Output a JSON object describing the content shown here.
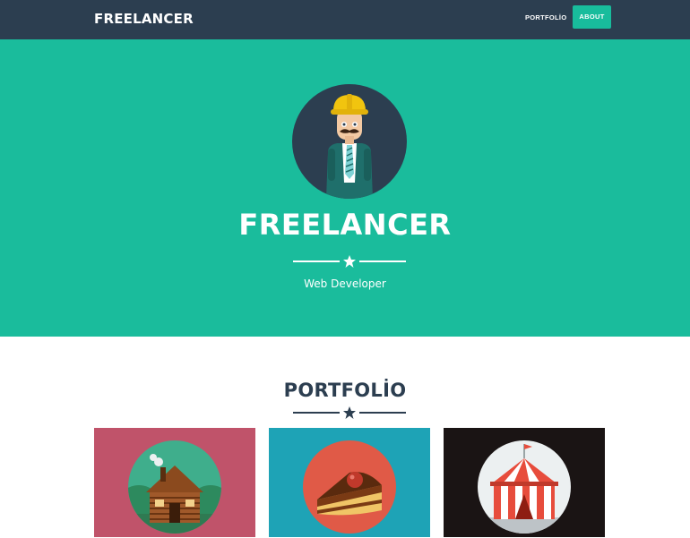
{
  "navbar": {
    "brand": "FREELANCER",
    "links": [
      {
        "label": "PORTFOLİO"
      },
      {
        "label": "ABOUT",
        "active": true
      }
    ]
  },
  "header": {
    "title": "FREELANCER",
    "subtitle": "Web Developer",
    "divider_icon": "star-icon"
  },
  "portfolio": {
    "title": "PORTFOLİO",
    "divider_icon": "star-icon",
    "items": [
      {
        "icon": "cabin-icon",
        "bg": "#c0536a"
      },
      {
        "icon": "cake-icon",
        "bg": "#1ea3b6"
      },
      {
        "icon": "circus-tent-icon",
        "bg": "#1a1414"
      }
    ]
  },
  "colors": {
    "navbar": "#2c3e50",
    "primary": "#18bc9c",
    "header_bg": "#1abc9c",
    "dark": "#2c3e50"
  }
}
